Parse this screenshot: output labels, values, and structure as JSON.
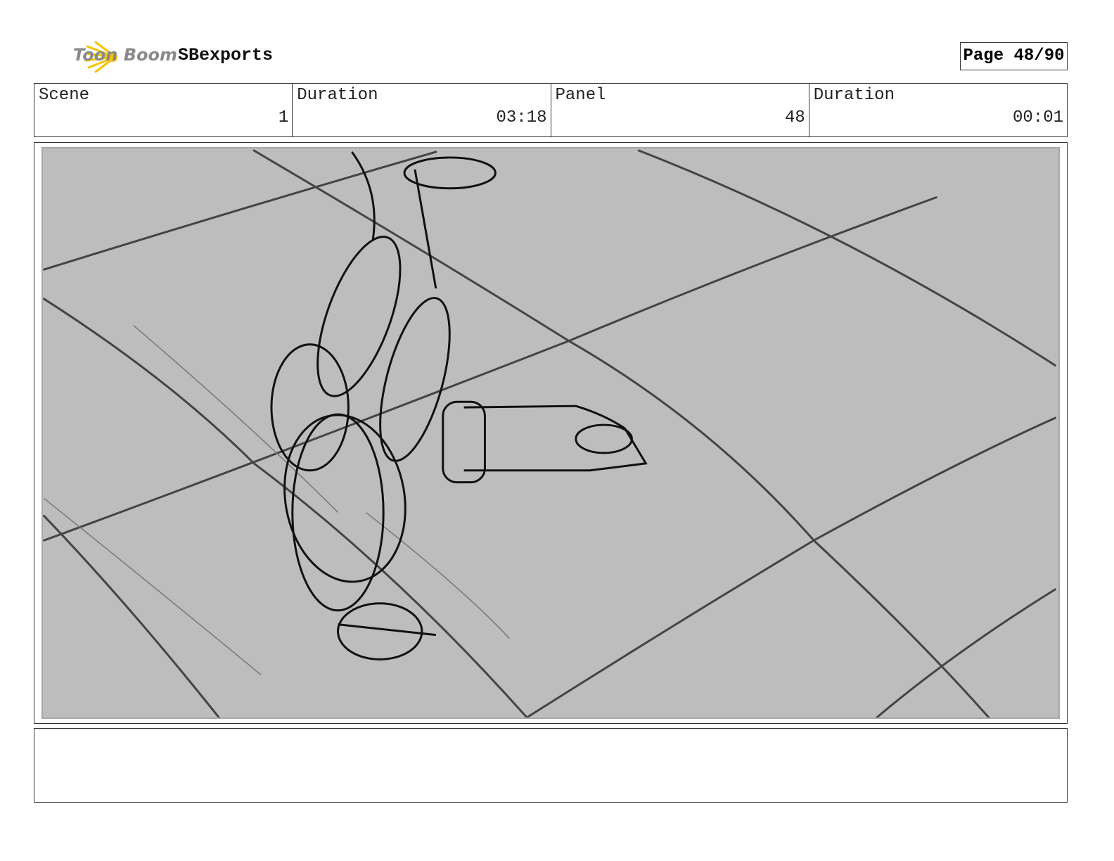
{
  "header": {
    "logo_text": "Toon Boom",
    "project": "SBexports",
    "page_label": "Page 48/90"
  },
  "info": [
    {
      "label": "Scene",
      "value": "1"
    },
    {
      "label": "Duration",
      "value": "03:18"
    },
    {
      "label": "Panel",
      "value": "48"
    },
    {
      "label": "Duration",
      "value": "00:01"
    }
  ],
  "notes": "",
  "colors": {
    "sketch_bg": "#bdbdbd",
    "logo_accent": "#f5c400"
  }
}
